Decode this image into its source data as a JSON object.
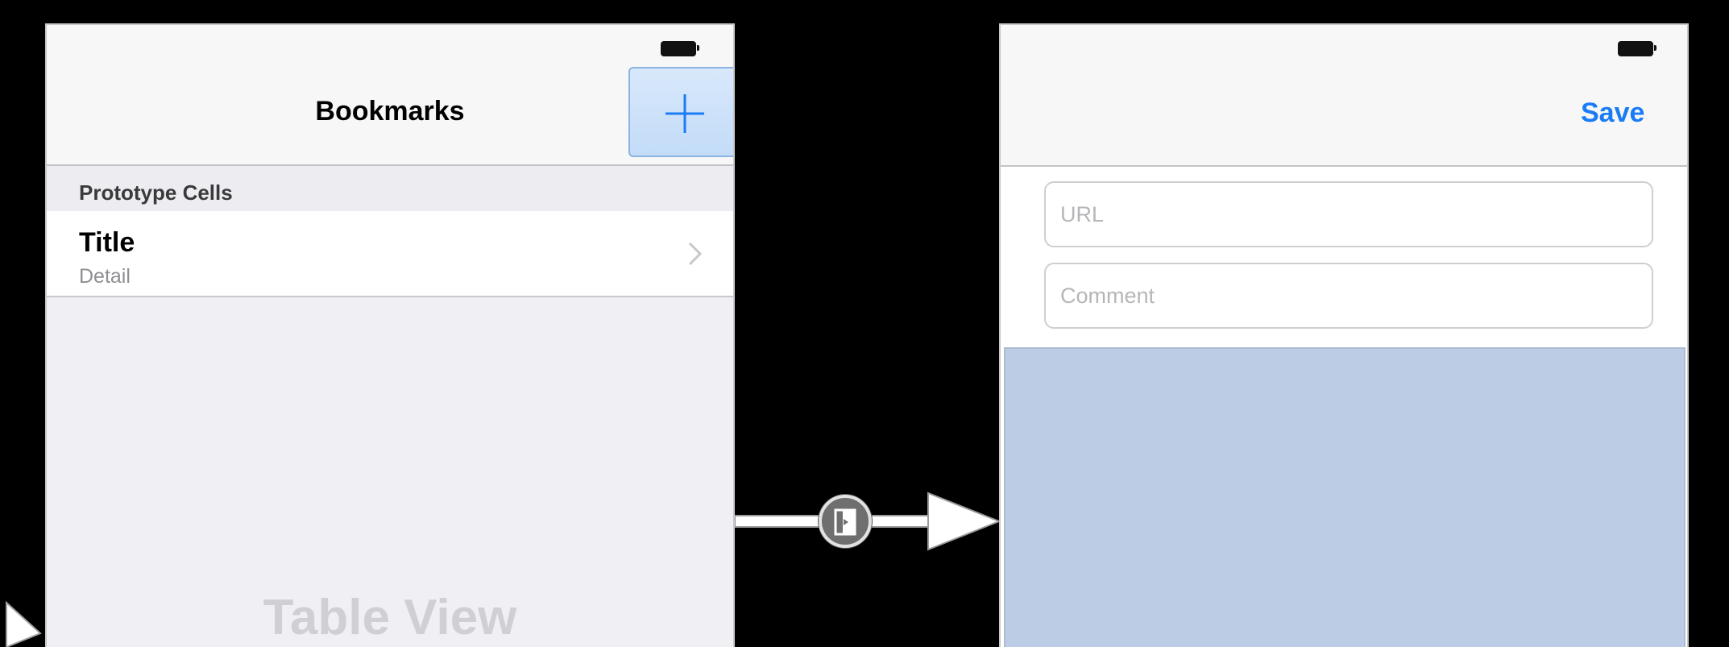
{
  "left_scene": {
    "nav_title": "Bookmarks",
    "add_button_icon": "plus-icon",
    "section_header": "Prototype Cells",
    "cell": {
      "title": "Title",
      "detail": "Detail",
      "accessory_icon": "chevron-right-icon"
    },
    "table_view_label": "Table View"
  },
  "segue": {
    "icon": "segue-icon"
  },
  "right_scene": {
    "save_label": "Save",
    "url_placeholder": "URL",
    "comment_placeholder": "Comment"
  },
  "colors": {
    "accent": "#1a7cf5",
    "content_view": "#bccce5",
    "canvas": "#000000"
  }
}
